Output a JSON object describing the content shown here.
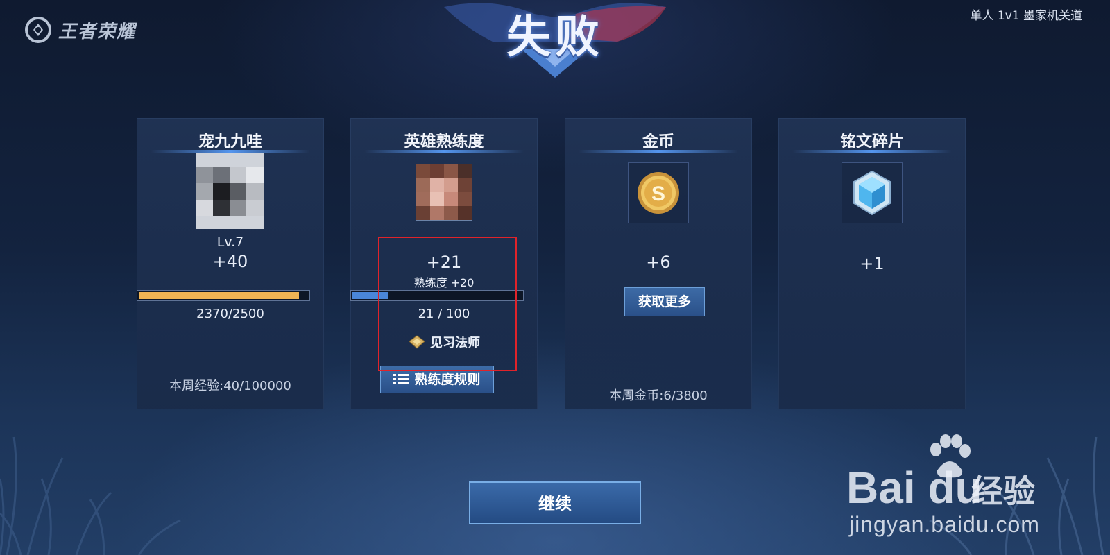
{
  "header": {
    "logo_text": "王者荣耀",
    "mode_label": "单人 1v1 墨家机关道",
    "result_title": "失败"
  },
  "cards": {
    "player": {
      "title": "宠九九哇",
      "level": "Lv.7",
      "gain": "+40",
      "progress_text": "2370/2500",
      "progress": 0.948,
      "weekly": "本周经验:40/100000"
    },
    "hero": {
      "title": "英雄熟练度",
      "gain": "+21",
      "detail": "熟练度 +20",
      "progress_text": "21 / 100",
      "progress": 0.21,
      "rank": "见习法师",
      "rules_button": "熟练度规则",
      "rules_icon": "list-icon"
    },
    "gold": {
      "title": "金币",
      "gain": "+6",
      "more_button": "获取更多",
      "weekly": "本周金币:6/3800",
      "icon": "gold-coin-icon"
    },
    "inscription": {
      "title": "铭文碎片",
      "gain": "+1",
      "icon": "inscription-shard-icon"
    }
  },
  "continue_button": "继续",
  "watermark": {
    "brand": "Bai du",
    "product": "经验",
    "url": "jingyan.baidu.com"
  },
  "colors": {
    "exp_bar": "#f0b454",
    "mastery_bar": "#4a86d8",
    "highlight_box": "#e0232a"
  }
}
